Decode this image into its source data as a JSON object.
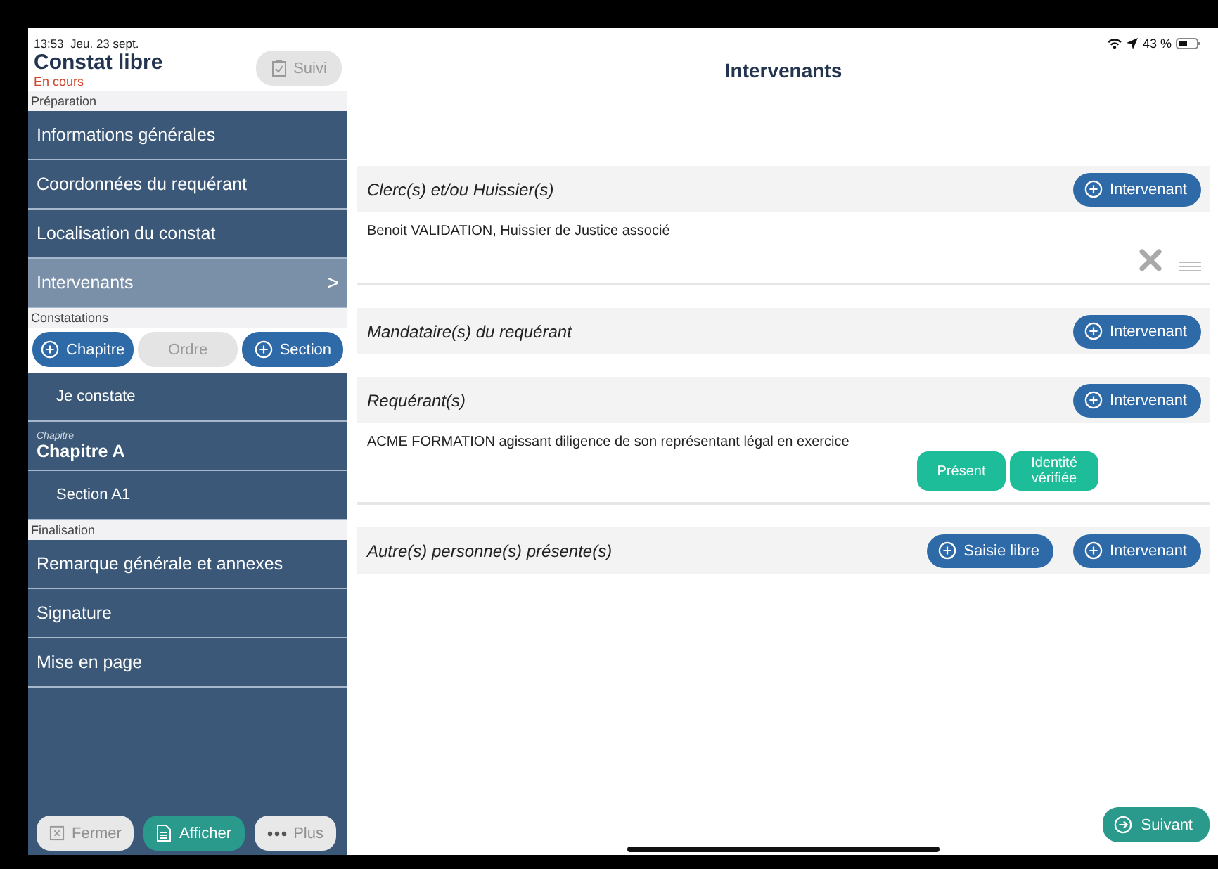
{
  "status_bar": {
    "time": "13:53",
    "date": "Jeu. 23 sept.",
    "battery": "43 %"
  },
  "sidebar": {
    "title": "Constat libre",
    "status": "En cours",
    "track_button": {
      "label": "Suivi",
      "disabled": true
    },
    "groups": [
      {
        "label": "Préparation",
        "items": [
          {
            "kind": "item",
            "label": "Informations générales",
            "selected": false
          },
          {
            "kind": "item",
            "label": "Coordonnées du requérant",
            "selected": false
          },
          {
            "kind": "item",
            "label": "Localisation du constat",
            "selected": false
          },
          {
            "kind": "item",
            "label": "Intervenants",
            "selected": true,
            "chevron": ">"
          }
        ]
      },
      {
        "label": "Constatations",
        "buttons": [
          {
            "label": "Chapitre",
            "kind": "add",
            "disabled": false
          },
          {
            "label": "Ordre",
            "kind": "plain",
            "disabled": true
          },
          {
            "label": "Section",
            "kind": "add",
            "disabled": false
          }
        ],
        "items": [
          {
            "kind": "sub",
            "label": "Je constate",
            "selected": false
          },
          {
            "kind": "chapter",
            "caption": "Chapitre",
            "label": "Chapitre A",
            "selected": false
          },
          {
            "kind": "sub",
            "label": "Section A1",
            "selected": false
          }
        ]
      },
      {
        "label": "Finalisation",
        "items": [
          {
            "kind": "item",
            "label": "Remarque générale et annexes",
            "selected": false
          },
          {
            "kind": "item",
            "label": "Signature",
            "selected": false
          },
          {
            "kind": "item",
            "label": "Mise en page",
            "selected": false
          }
        ]
      }
    ],
    "footer": [
      {
        "label": "Fermer",
        "kind": "close",
        "disabled": true
      },
      {
        "label": "Afficher",
        "kind": "document",
        "disabled": false
      },
      {
        "label": "Plus",
        "kind": "more",
        "disabled": true
      }
    ]
  },
  "main": {
    "title": "Intervenants",
    "sections": [
      {
        "title": "Clerc(s) et/ou Huissier(s)",
        "buttons": [
          "Intervenant"
        ],
        "entries": [
          {
            "text": "Benoit VALIDATION, Huissier de Justice associé",
            "kind": "removable"
          }
        ]
      },
      {
        "title": "Mandataire(s) du requérant",
        "buttons": [
          "Intervenant"
        ]
      },
      {
        "title": "Requérant(s)",
        "buttons": [
          "Intervenant"
        ],
        "entries": [
          {
            "text": "ACME FORMATION agissant diligence de son représentant légal en exercice",
            "kind": "tagged",
            "tags": [
              "Présent",
              "Identité vérifiée"
            ]
          }
        ]
      },
      {
        "title": "Autre(s) personne(s) présente(s)",
        "buttons": [
          "Saisie libre",
          "Intervenant"
        ]
      }
    ],
    "next_button": "Suivant"
  }
}
